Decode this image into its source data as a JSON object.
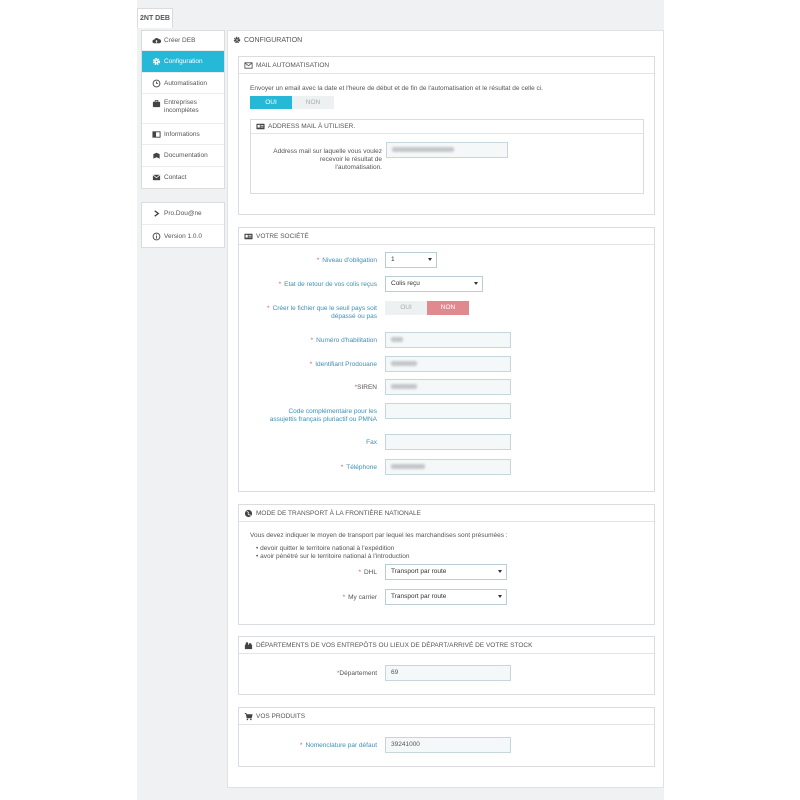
{
  "tab": {
    "label": "2NT DEB"
  },
  "sidebar": {
    "items": [
      {
        "label": "Créer DEB",
        "icon": "cloud-upload-icon"
      },
      {
        "label": "Configuration",
        "icon": "gear-icon"
      },
      {
        "label": "Automatisation",
        "icon": "clock-icon"
      },
      {
        "label": "Entreprises incomplètes",
        "icon": "briefcase-icon"
      },
      {
        "label": "Informations",
        "icon": "book-icon"
      },
      {
        "label": "Documentation",
        "icon": "document-icon"
      },
      {
        "label": "Contact",
        "icon": "envelope-icon"
      }
    ],
    "extra": [
      {
        "label": "Pro.Dou@ne",
        "icon": "chevron-right-icon"
      },
      {
        "label": "Version 1.0.0",
        "icon": "info-icon"
      }
    ]
  },
  "main": {
    "title": "CONFIGURATION"
  },
  "mail": {
    "title": "MAIL AUTOMATISATION",
    "description": "Envoyer un email avec la date et l'heure de début et de fin de l'automatisation et le résultat de celle ci.",
    "toggle": {
      "yes": "OUI",
      "no": "NON",
      "selected": "yes"
    },
    "address": {
      "title": "ADDRESS MAIL À UTILISER.",
      "label_line1": "Address mail sur laquelle vous voulez",
      "label_line2": "recevoir le résultat de",
      "label_line3": "l'automatisation."
    }
  },
  "company": {
    "title": "VOTRE SOCIÉTÉ",
    "niveau_label": "Niveau d'obligation",
    "niveau_value": "1",
    "etat_label": "Etat de retour de vos colis reçus",
    "etat_value": "Colis reçu",
    "creer_label1": "Créer le fichier que le seuil pays soit",
    "creer_label2": "dépassé ou pas",
    "toggle": {
      "yes": "OUI",
      "no": "NON",
      "selected": "no"
    },
    "numero_label": "Numéro d'habilitation",
    "identifiant_label": "Identifiant Prodouane",
    "siren_label": "SIREN",
    "code_label1": "Code complémentaire pour les",
    "code_label2": "assujettis français pluriactif ou PMNA",
    "fax_label": "Fax",
    "telephone_label": "Téléphone"
  },
  "transport": {
    "title": "MODE DE TRANSPORT À LA FRONTIÈRE NATIONALE",
    "intro": "Vous devez indiquer le moyen de transport par lequel les marchandises sont présumées :",
    "bullets": [
      "devoir quitter le territoire national à l'expédition",
      "avoir pénétré sur le territoire national à l'introduction"
    ],
    "carriers": [
      {
        "label": "DHL",
        "value": "Transport par route"
      },
      {
        "label": "My carrier",
        "value": "Transport par route"
      }
    ]
  },
  "departements": {
    "title": "DÉPARTEMENTS DE VOS ENTREPÔTS OU LIEUX DE DÉPART/ARRIVÉ DE VOTRE STOCK",
    "label": "Département",
    "value": "69"
  },
  "produits": {
    "title": "VOS PRODUITS",
    "label": "Nomenclature par défaut",
    "value": "39241000"
  }
}
